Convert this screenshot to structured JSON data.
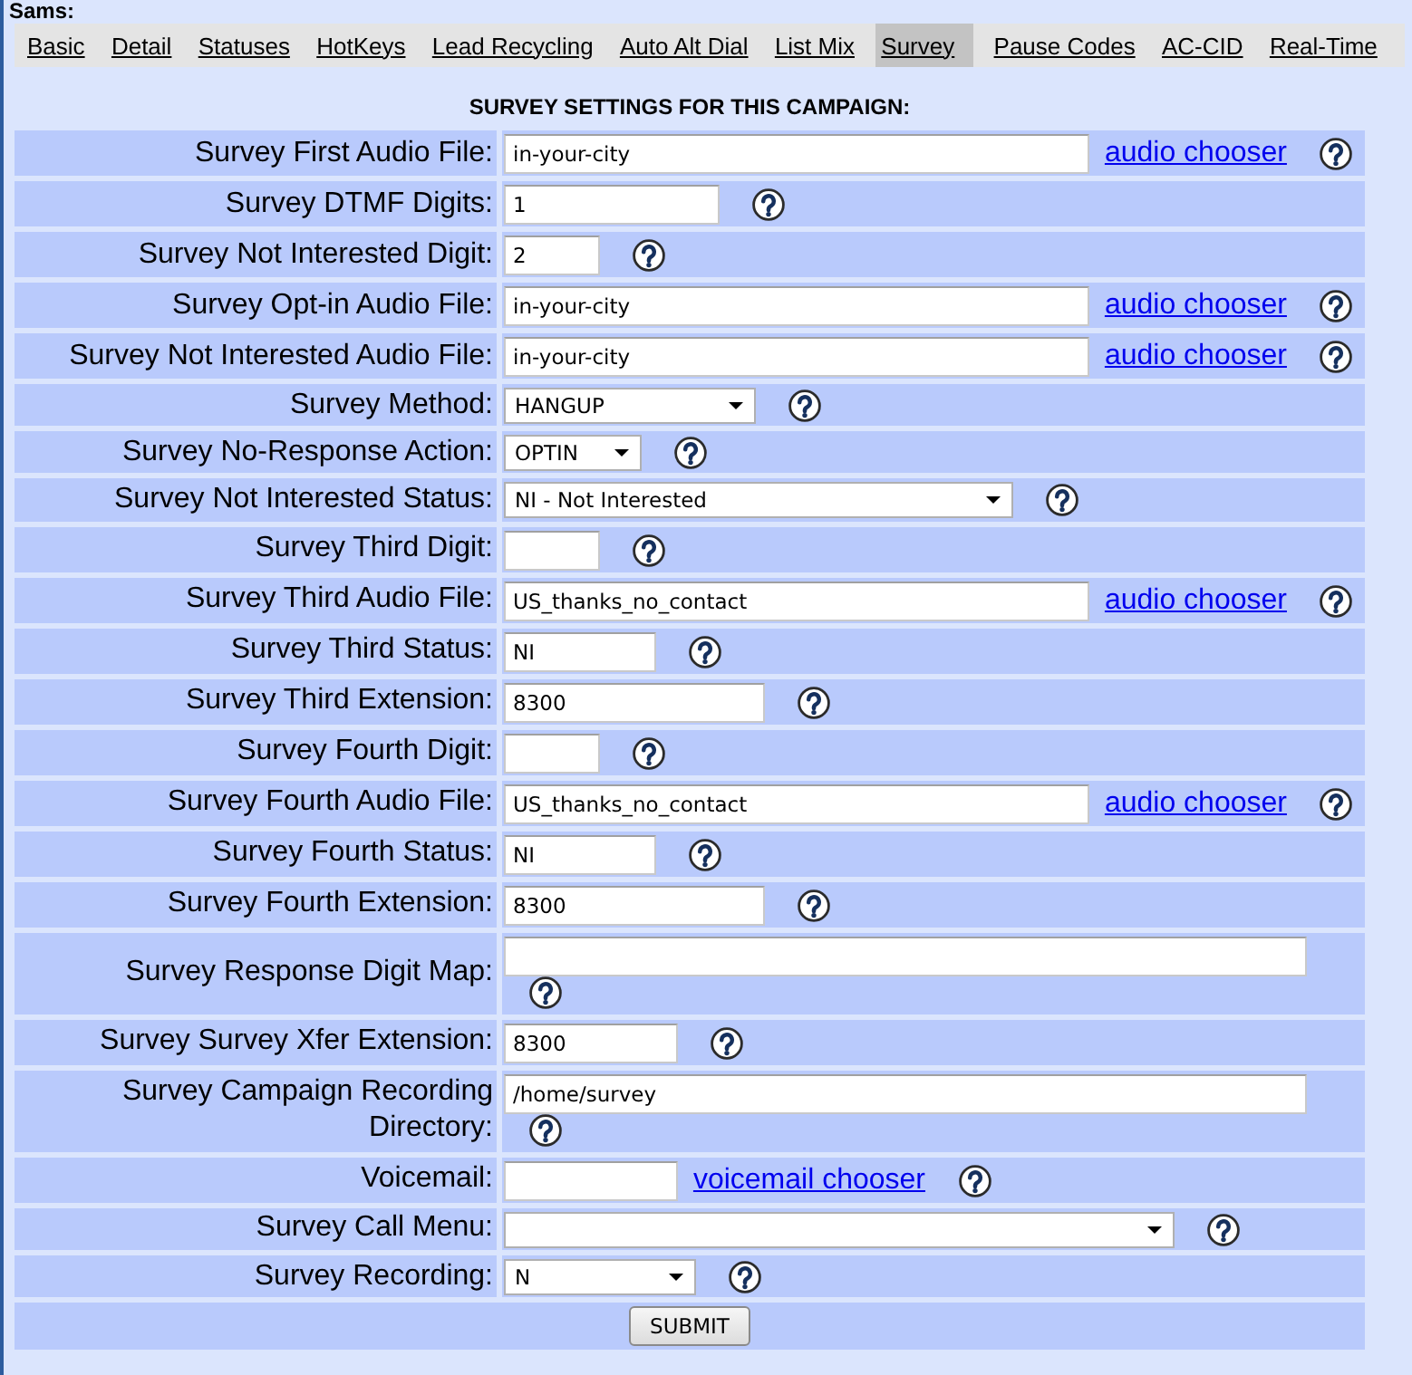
{
  "header": {
    "title": "Sams:"
  },
  "tabs": [
    {
      "label": "Basic",
      "selected": false
    },
    {
      "label": "Detail",
      "selected": false
    },
    {
      "label": "Statuses",
      "selected": false
    },
    {
      "label": "HotKeys",
      "selected": false
    },
    {
      "label": "Lead Recycling",
      "selected": false
    },
    {
      "label": "Auto Alt Dial",
      "selected": false
    },
    {
      "label": "List Mix",
      "selected": false
    },
    {
      "label": "Survey",
      "selected": true
    },
    {
      "label": "Pause Codes",
      "selected": false
    },
    {
      "label": "AC-CID",
      "selected": false
    },
    {
      "label": "Real-Time",
      "selected": false
    }
  ],
  "section_title": "SURVEY SETTINGS FOR THIS CAMPAIGN:",
  "fields": [
    {
      "label": "Survey First Audio File:",
      "kind": "text",
      "value": "in-your-city",
      "link": "audio chooser"
    },
    {
      "label": "Survey DTMF Digits:",
      "kind": "text",
      "value": "1"
    },
    {
      "label": "Survey Not Interested Digit:",
      "kind": "text",
      "value": "2"
    },
    {
      "label": "Survey Opt-in Audio File:",
      "kind": "text",
      "value": "in-your-city",
      "link": "audio chooser"
    },
    {
      "label": "Survey Not Interested Audio File:",
      "kind": "text",
      "value": "in-your-city",
      "link": "audio chooser"
    },
    {
      "label": "Survey Method:",
      "kind": "select",
      "value": "HANGUP"
    },
    {
      "label": "Survey No-Response Action:",
      "kind": "select",
      "value": "OPTIN"
    },
    {
      "label": "Survey Not Interested Status:",
      "kind": "select",
      "value": "NI - Not Interested"
    },
    {
      "label": "Survey Third Digit:",
      "kind": "text"
    },
    {
      "label": "Survey Third Audio File:",
      "kind": "text",
      "value": "US_thanks_no_contact",
      "link": "audio chooser"
    },
    {
      "label": "Survey Third Status:",
      "kind": "text",
      "value": "NI"
    },
    {
      "label": "Survey Third Extension:",
      "kind": "text",
      "value": "8300"
    },
    {
      "label": "Survey Fourth Digit:",
      "kind": "text"
    },
    {
      "label": "Survey Fourth Audio File:",
      "kind": "text",
      "value": "US_thanks_no_contact",
      "link": "audio chooser"
    },
    {
      "label": "Survey Fourth Status:",
      "kind": "text",
      "value": "NI"
    },
    {
      "label": "Survey Fourth Extension:",
      "kind": "text",
      "value": "8300"
    },
    {
      "label": "Survey Response Digit Map:",
      "kind": "text"
    },
    {
      "label": "Survey Survey Xfer Extension:",
      "kind": "text",
      "value": "8300"
    },
    {
      "label": "Survey Campaign Recording Directory:",
      "kind": "text",
      "value": "/home/survey"
    },
    {
      "label": "Voicemail:",
      "kind": "text",
      "link": "voicemail chooser"
    },
    {
      "label": "Survey Call Menu:",
      "kind": "select"
    },
    {
      "label": "Survey Recording:",
      "kind": "select",
      "value": "N"
    }
  ],
  "submit": "SUBMIT"
}
